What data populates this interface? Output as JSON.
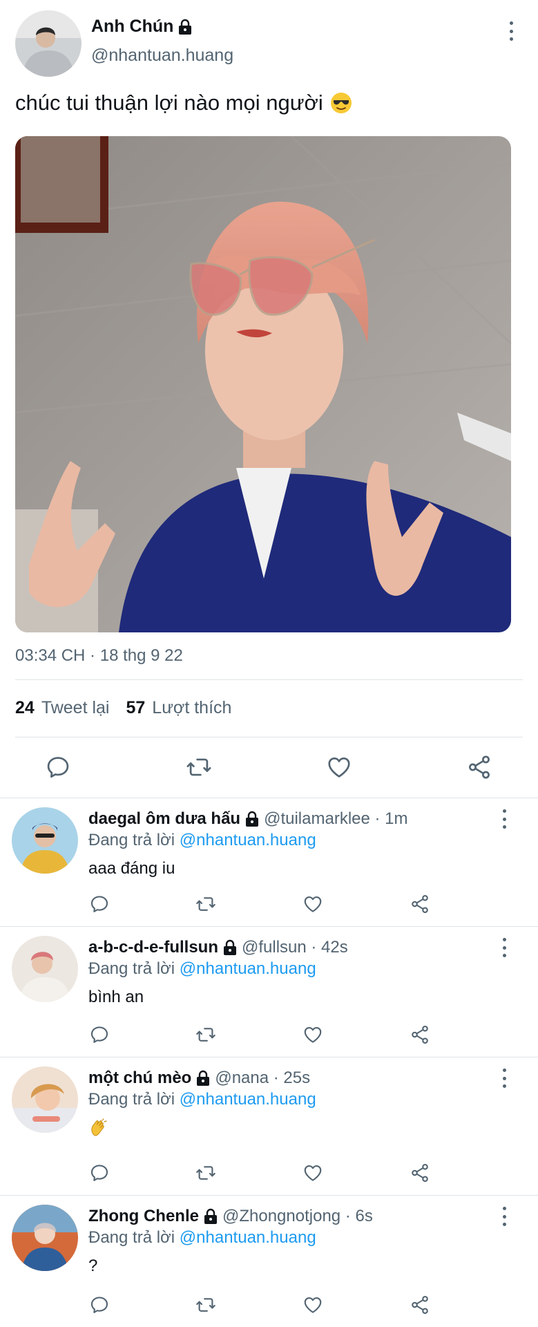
{
  "tweet": {
    "author_name": "Anh Chún",
    "author_handle": "@nhantuan.huang",
    "text": "chúc tui thuận lợi nào mọi người",
    "text_emoji": "smiling-face-with-sunglasses",
    "timestamp": "03:34 CH · 18 thg 9 22",
    "retweets_count": "24",
    "retweets_label": "Tweet lại",
    "likes_count": "57",
    "likes_label": "Lượt thích"
  },
  "replies": [
    {
      "name": "daegal ôm dưa hấu",
      "meta": "@tuilamarklee · 1m",
      "replying_prefix": "Đang trả lời",
      "replying_to": "@nhantuan.huang",
      "text": "aaa đáng iu"
    },
    {
      "name": "a-b-c-d-e-fullsun",
      "meta": "@fullsun · 42s",
      "replying_prefix": "Đang trả lời",
      "replying_to": "@nhantuan.huang",
      "text": "bình an"
    },
    {
      "name": "một chú mèo",
      "meta": "@nana · 25s",
      "replying_prefix": "Đang trả lời",
      "replying_to": "@nhantuan.huang",
      "text": "",
      "emoji": "clapping-hands"
    },
    {
      "name": "Zhong Chenle",
      "meta": "@Zhongnotjong · 6s",
      "replying_prefix": "Đang trả lời",
      "replying_to": "@nhantuan.huang",
      "text": "?"
    }
  ],
  "colors": {
    "text_primary": "#0f1419",
    "text_secondary": "#536471",
    "mention": "#1d9bf0",
    "divider": "#dfe3e6"
  }
}
